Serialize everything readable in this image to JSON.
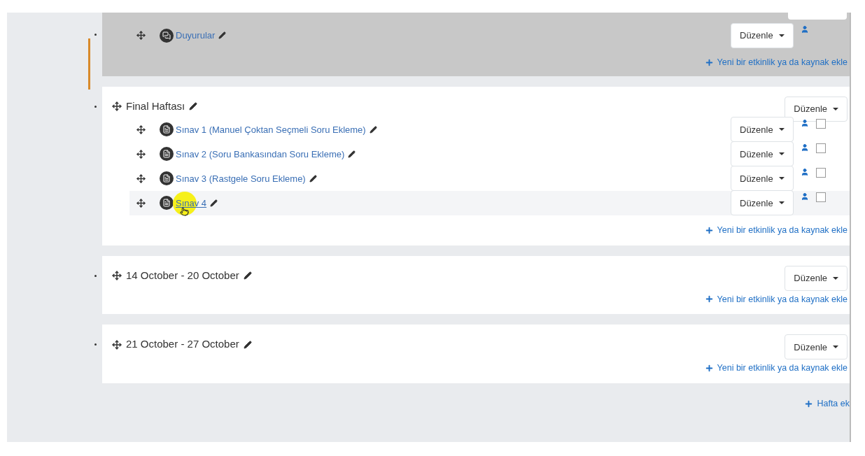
{
  "sections": [
    {
      "highlighted": true,
      "activities": [
        {
          "title": "Duyurular",
          "kind": "forum",
          "hovered": false,
          "edit_label": "Düzenle"
        }
      ],
      "add_link": "Yeni bir etkinlik ya da kaynak ekle"
    },
    {
      "highlighted": false,
      "title": "Final Haftası",
      "edit_label": "Düzenle",
      "activities": [
        {
          "title": "Sınav 1 (Manuel Çoktan Seçmeli Soru Ekleme)",
          "kind": "quiz",
          "hovered": false,
          "edit_label": "Düzenle",
          "checked": false
        },
        {
          "title": "Sınav 2 (Soru Bankasından Soru Ekleme)",
          "kind": "quiz",
          "hovered": false,
          "edit_label": "Düzenle",
          "checked": false
        },
        {
          "title": "Sınav 3 (Rastgele Soru Ekleme)",
          "kind": "quiz",
          "hovered": false,
          "edit_label": "Düzenle",
          "checked": false
        },
        {
          "title": "Sınav 4",
          "kind": "quiz",
          "hovered": true,
          "edit_label": "Düzenle",
          "checked": false
        }
      ],
      "add_link": "Yeni bir etkinlik ya da kaynak ekle"
    },
    {
      "highlighted": false,
      "title": "14 October - 20 October",
      "edit_label": "Düzenle",
      "add_link": "Yeni bir etkinlik ya da kaynak ekle"
    },
    {
      "highlighted": false,
      "title": "21 October - 27 October",
      "edit_label": "Düzenle",
      "add_link": "Yeni bir etkinlik ya da kaynak ekle"
    }
  ],
  "add_week": "Hafta ek"
}
